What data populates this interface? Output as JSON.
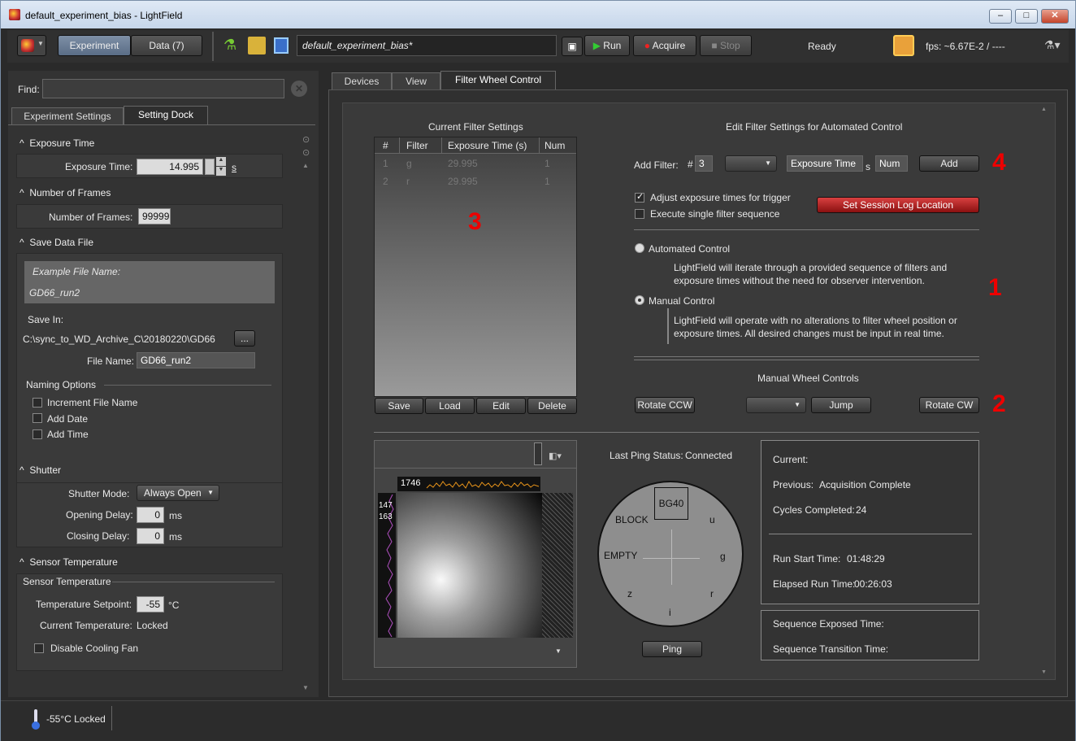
{
  "window": {
    "title": "default_experiment_bias - LightField",
    "min": "–",
    "max": "□",
    "close": "✕"
  },
  "toolbar": {
    "experiment_tab": "Experiment",
    "data_tab": "Data (7)",
    "experiment_name": "default_experiment_bias*",
    "run": "Run",
    "acquire": "Acquire",
    "stop": "Stop",
    "status": "Ready",
    "fps": "fps:  ~6.67E-2 / ----"
  },
  "left": {
    "find_label": "Find:",
    "tabs": [
      "Experiment Settings",
      "Setting Dock"
    ],
    "exposure": {
      "header": "Exposure Time",
      "label": "Exposure Time:",
      "value": "14.995",
      "unit": "s"
    },
    "frames": {
      "header": "Number of Frames",
      "label": "Number of Frames:",
      "value": "99999"
    },
    "save": {
      "header": "Save Data File",
      "example_label": "Example File Name:",
      "example_value": "GD66_run2",
      "save_in_label": "Save In:",
      "save_in_path": "C:\\sync_to_WD_Archive_C\\20180220\\GD66",
      "browse": "...",
      "file_name_label": "File Name:",
      "file_name_value": "GD66_run2",
      "naming_label": "Naming Options",
      "opts": [
        "Increment File Name",
        "Add Date",
        "Add Time"
      ]
    },
    "shutter": {
      "header": "Shutter",
      "mode_label": "Shutter Mode:",
      "mode_value": "Always Open",
      "open_label": "Opening Delay:",
      "open_value": "0",
      "close_label": "Closing Delay:",
      "close_value": "0",
      "unit": "ms"
    },
    "sensor": {
      "header": "Sensor Temperature",
      "sub": "Sensor Temperature",
      "setpoint_label": "Temperature Setpoint:",
      "setpoint_value": "-55",
      "setpoint_unit": "°C",
      "current_label": "Current Temperature:",
      "current_value": "Locked",
      "fan_label": "Disable Cooling Fan"
    }
  },
  "right": {
    "tabs": [
      "Devices",
      "View",
      "Filter Wheel Control"
    ],
    "current_title": "Current Filter Settings",
    "table": {
      "headers": [
        "#",
        "Filter",
        "Exposure Time (s)",
        "Num"
      ],
      "rows": [
        [
          "1",
          "g",
          "29.995",
          "1"
        ],
        [
          "2",
          "r",
          "29.995",
          "1"
        ]
      ]
    },
    "table_buttons": [
      "Save",
      "Load",
      "Edit",
      "Delete"
    ],
    "edit_title": "Edit Filter Settings for Automated Control",
    "add_filter_label": "Add Filter:",
    "hash": "#",
    "add_num": "3",
    "exposure_placeholder": "Exposure Time",
    "s": "s",
    "num_placeholder": "Num",
    "add_btn": "Add",
    "adjust_label": "Adjust exposure times for trigger",
    "single_label": "Execute single filter sequence",
    "session_btn": "Set Session Log Location",
    "auto_label": "Automated Control",
    "auto_desc1": "LightField will iterate through a provided sequence of filters and",
    "auto_desc2": "exposure times without the need for observer intervention.",
    "manual_label": "Manual Control",
    "manual_desc1": "LightField will operate with no alterations to filter wheel position or",
    "manual_desc2": "exposure times.  All desired changes must be input in real time.",
    "manual_title": "Manual Wheel Controls",
    "rot_ccw": "Rotate CCW",
    "jump": "Jump",
    "rot_cw": "Rotate CW",
    "ping_label": "Last Ping Status:",
    "ping_value": "Connected",
    "wheel": {
      "top": "BG40",
      "labels": [
        "BLOCK",
        "u",
        "EMPTY",
        "g",
        "z",
        "r",
        "i"
      ]
    },
    "ping_btn": "Ping",
    "image": {
      "top_value": "1746",
      "side1": "147",
      "side2": "163"
    },
    "status": {
      "current": "Current:",
      "previous_label": "Previous:",
      "previous_value": "Acquisition Complete",
      "cycles_label": "Cycles Completed:",
      "cycles_value": "24",
      "start_label": "Run Start Time:",
      "start_value": "01:48:29",
      "elapsed_label": "Elapsed Run Time:",
      "elapsed_value": "00:26:03",
      "seq_exposed": "Sequence Exposed Time:",
      "seq_trans": "Sequence Transition Time:"
    },
    "markers": [
      "1",
      "2",
      "3",
      "4"
    ]
  },
  "statusbar": {
    "temp": "-55°C Locked"
  },
  "colors": {
    "accent_red": "#e00000",
    "bg": "#2a2a2a"
  }
}
